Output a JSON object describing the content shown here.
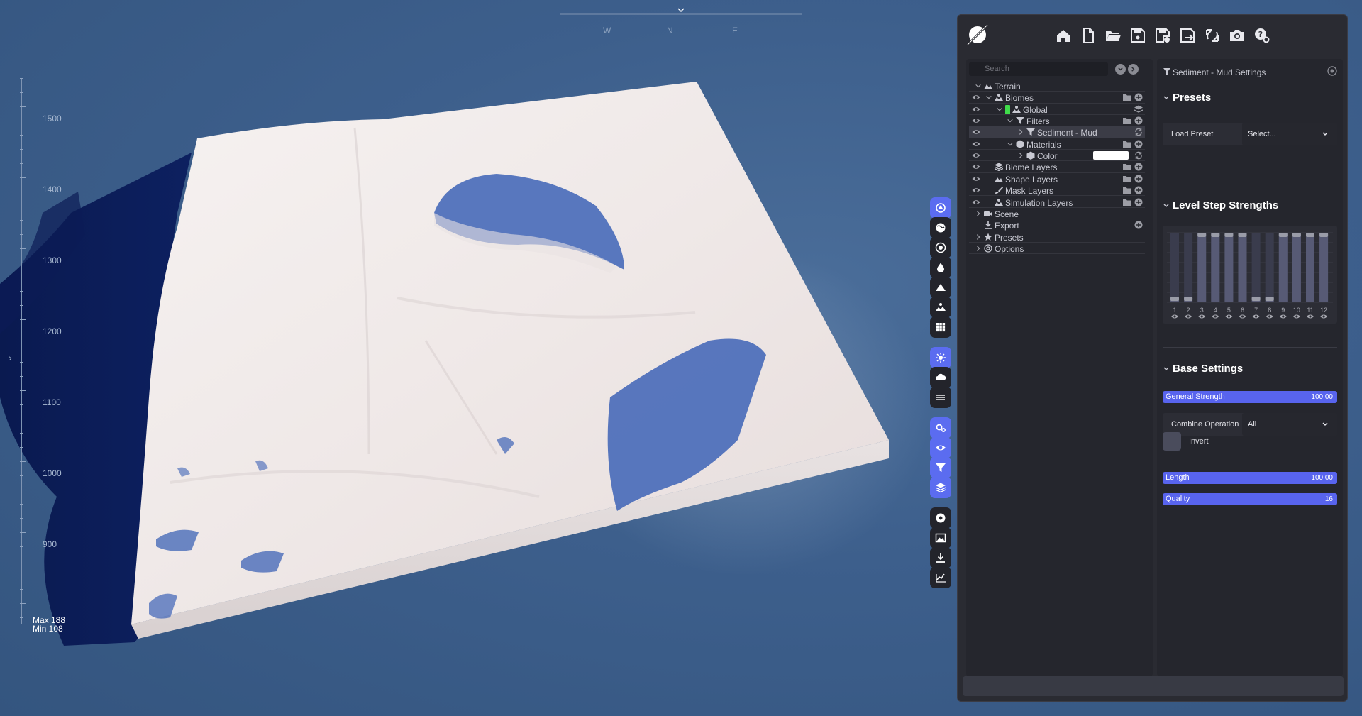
{
  "viewport": {
    "compass": [
      "W",
      "N",
      "E"
    ],
    "ruler_labels": [
      "1500",
      "1400",
      "1300",
      "1200",
      "1100",
      "1000",
      "900"
    ],
    "max_label": "Max 188",
    "min_label": "Min 108"
  },
  "tools": [
    {
      "name": "terrain-tool",
      "icon": "circle-arrow-icon",
      "active": true
    },
    {
      "name": "sphere-tool",
      "icon": "globe-icon",
      "active": false
    },
    {
      "name": "target-tool",
      "icon": "target-icon",
      "active": false
    },
    {
      "name": "water-tool",
      "icon": "droplet-icon",
      "active": false
    },
    {
      "name": "mountain-tool",
      "icon": "mountain-icon",
      "active": false
    },
    {
      "name": "landscape-tool",
      "icon": "landscape-icon",
      "active": false
    },
    {
      "name": "grid-tool",
      "icon": "grid-icon",
      "active": false
    },
    {
      "name": "sun-tool",
      "icon": "sun-icon",
      "active": true
    },
    {
      "name": "clouds-tool",
      "icon": "cloud-icon",
      "active": false
    },
    {
      "name": "fog-tool",
      "icon": "fog-icon",
      "active": false
    },
    {
      "name": "settings-tool",
      "icon": "gears-icon",
      "active": true
    },
    {
      "name": "view-tool",
      "icon": "eye-icon",
      "active": true
    },
    {
      "name": "filter-tool",
      "icon": "filter-icon",
      "active": true
    },
    {
      "name": "layers-tool",
      "icon": "layers-icon",
      "active": true
    },
    {
      "name": "record-tool",
      "icon": "record-icon",
      "active": false
    },
    {
      "name": "image-tool",
      "icon": "image-icon",
      "active": false
    },
    {
      "name": "download-tool",
      "icon": "download-icon",
      "active": false
    },
    {
      "name": "stats-tool",
      "icon": "chart-icon",
      "active": false
    }
  ],
  "header_buttons": [
    {
      "name": "home-button",
      "icon": "home-icon"
    },
    {
      "name": "new-file-button",
      "icon": "new-file-icon"
    },
    {
      "name": "open-folder-button",
      "icon": "folder-open-icon"
    },
    {
      "name": "save-button",
      "icon": "save-icon"
    },
    {
      "name": "save-as-button",
      "icon": "save-plus-icon"
    },
    {
      "name": "export-button",
      "icon": "export-icon"
    },
    {
      "name": "refresh-button",
      "icon": "refresh-icon"
    },
    {
      "name": "screenshot-button",
      "icon": "camera-icon"
    },
    {
      "name": "help-button",
      "icon": "help-icon"
    }
  ],
  "tree": {
    "search_placeholder": "Search",
    "rows": [
      {
        "label": "Terrain"
      },
      {
        "label": "Biomes"
      },
      {
        "label": "Global"
      },
      {
        "label": "Filters"
      },
      {
        "label": "Sediment - Mud"
      },
      {
        "label": "Materials"
      },
      {
        "label": "Color"
      },
      {
        "label": "Biome Layers"
      },
      {
        "label": "Shape Layers"
      },
      {
        "label": "Mask Layers"
      },
      {
        "label": "Simulation Layers"
      },
      {
        "label": "Scene"
      },
      {
        "label": "Export"
      },
      {
        "label": "Presets"
      },
      {
        "label": "Options"
      }
    ]
  },
  "settings": {
    "title": "Sediment - Mud Settings",
    "presets": {
      "heading": "Presets",
      "load_label": "Load Preset",
      "select_value": "Select..."
    },
    "level_steps": {
      "heading": "Level Step Strengths",
      "labels": [
        "1",
        "2",
        "3",
        "4",
        "5",
        "6",
        "7",
        "8",
        "9",
        "10",
        "11",
        "12"
      ],
      "values": [
        0.08,
        0.08,
        1,
        1,
        1,
        1,
        0.08,
        0.08,
        1,
        1,
        1,
        1
      ]
    },
    "base": {
      "heading": "Base Settings",
      "general_strength_label": "General Strength",
      "general_strength_value": "100.00",
      "general_strength_fraction": 1.0,
      "combine_label": "Combine Operation",
      "combine_value": "All",
      "invert_label": "Invert",
      "length_label": "Length",
      "length_value": "100.00",
      "length_fraction": 1.0,
      "quality_label": "Quality",
      "quality_value": "16",
      "quality_fraction": 1.0
    }
  }
}
